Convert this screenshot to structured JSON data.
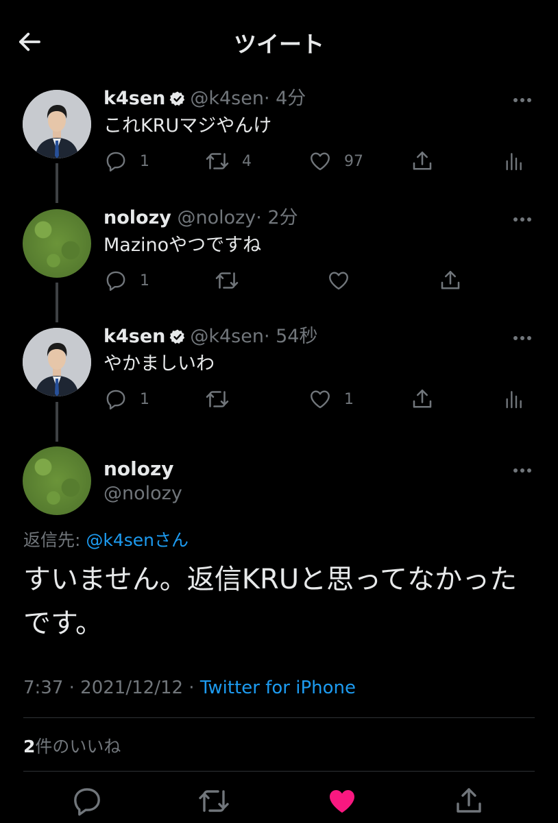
{
  "header": {
    "title": "ツイート"
  },
  "thread": [
    {
      "name": "k4sen",
      "verified": true,
      "handle": "@k4sen",
      "time": "· 4分",
      "text": "これKRUマジやんけ",
      "replies": "1",
      "retweets": "4",
      "likes": "97",
      "analytics": true
    },
    {
      "name": "nolozy",
      "verified": false,
      "handle": "@nolozy",
      "time": "· 2分",
      "text": "Mazinoやつですね",
      "replies": "1",
      "retweets": "",
      "likes": "",
      "analytics": false
    },
    {
      "name": "k4sen",
      "verified": true,
      "handle": "@k4sen",
      "time": "· 54秒",
      "text": "やかましいわ",
      "replies": "1",
      "retweets": "",
      "likes": "1",
      "analytics": true
    }
  ],
  "main_tweet": {
    "name": "nolozy",
    "handle": "@nolozy",
    "reply_prefix": "返信先: ",
    "reply_mention": "@k4senさん",
    "text_line1": "すいません。返信KRUと思ってなかった",
    "text_line2": "です。",
    "time": "7:37",
    "date": "· 2021/12/12 ·",
    "source": "Twitter for iPhone",
    "like_count": "2",
    "like_label": "件のいいね",
    "liked": true
  },
  "colors": {
    "background": "#000000",
    "accent": "#1d9bf0",
    "like": "#f91880",
    "muted": "#71767b",
    "text": "#e7e9ea"
  },
  "icons": [
    "back-arrow-icon",
    "verified-badge-icon",
    "more-icon",
    "reply-icon",
    "retweet-icon",
    "like-icon",
    "share-icon",
    "analytics-icon"
  ]
}
